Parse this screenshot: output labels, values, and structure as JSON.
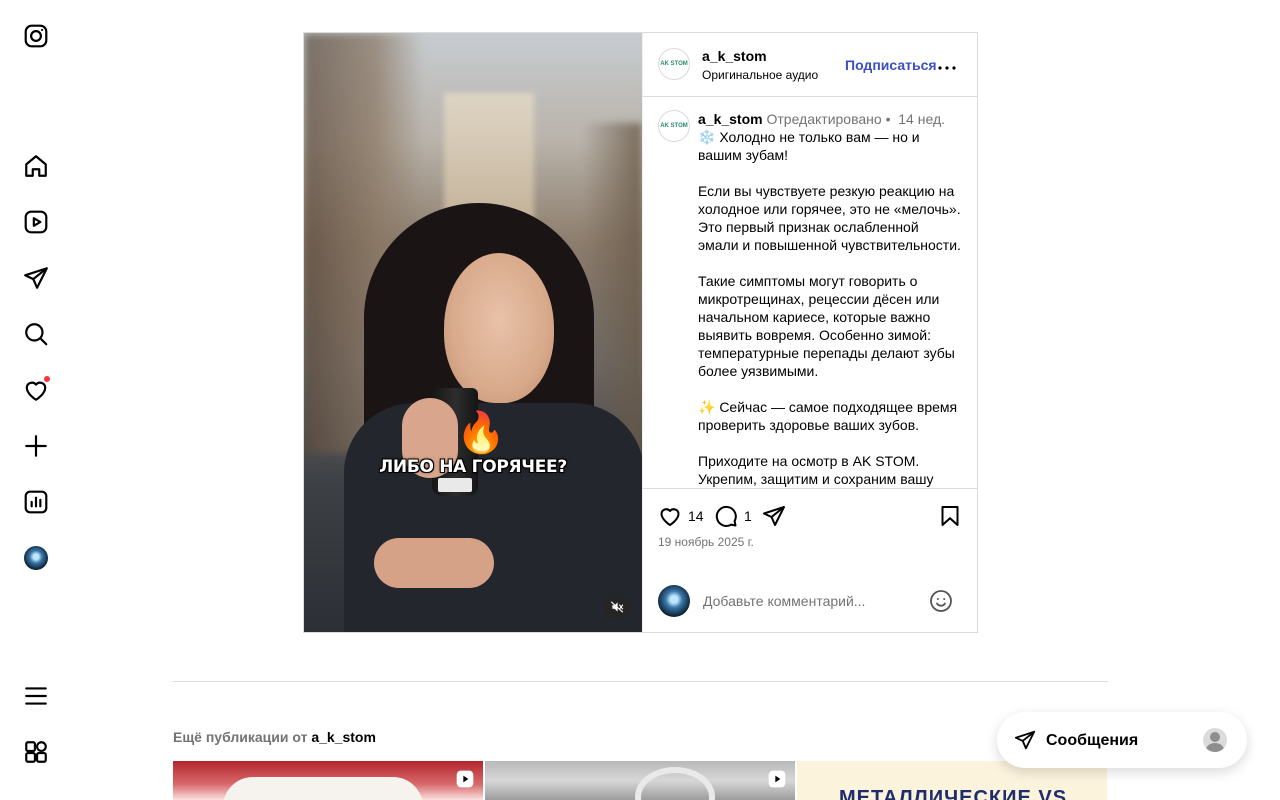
{
  "nav": {
    "items": [
      {
        "name": "instagram-logo-icon"
      },
      {
        "name": "home-icon"
      },
      {
        "name": "reels-icon"
      },
      {
        "name": "direct-messages-icon"
      },
      {
        "name": "search-icon"
      },
      {
        "name": "notifications-heart-icon"
      },
      {
        "name": "create-plus-icon"
      },
      {
        "name": "insights-dashboard-icon"
      },
      {
        "name": "profile-avatar"
      },
      {
        "name": "more-menu-icon"
      },
      {
        "name": "also-from-meta-icon"
      }
    ],
    "notification_dot_color": "#ff3040"
  },
  "post": {
    "media": {
      "overlay_text": "ЛИБО НА ГОРЯЧЕЕ?",
      "overlay_emoji": "🔥",
      "muted": true
    },
    "header": {
      "logo_text": "AK STOM",
      "username": "a_k_stom",
      "audio": "Оригинальное аудио",
      "follow_label": "Подписаться"
    },
    "caption": {
      "username": "a_k_stom",
      "edited": "Отредактировано",
      "separator": "•",
      "age": "14 нед.",
      "text": "❄️ Холодно не только вам — но и вашим зубам!\n\nЕсли вы чувствуете резкую реакцию на холодное или горячее, это не «мелочь». Это первый признак ослабленной эмали и повышенной чувствительности.\n\nТакие симптомы могут говорить о микротрещинах, рецессии дёсен или начальном кариесе, которые важно выявить вовремя. Особенно зимой: температурные перепады делают зубы более уязвимыми.\n\n✨ Сейчас — самое подходящее время проверить здоровье ваших зубов.\n\nПриходите на осмотр в AK STOM. Укрепим, защитим и сохраним вашу улыбку на долгие годы 🤍"
    },
    "actions": {
      "likes": "14",
      "comments": "1"
    },
    "date": "19 ноябрь 2025 г.",
    "comment_placeholder": "Добавьте комментарий..."
  },
  "more_posts": {
    "title_prefix": "Ещё публикации от",
    "username": "a_k_stom",
    "thumbs": [
      {
        "type": "reel"
      },
      {
        "type": "reel"
      },
      {
        "type": "image",
        "title": "МЕТАЛЛИЧЕСКИЕ VS"
      }
    ]
  },
  "messages": {
    "label": "Сообщения"
  },
  "colors": {
    "accent": "#3b4fc4",
    "muted_text": "#737373",
    "border": "#dbdbdb"
  }
}
